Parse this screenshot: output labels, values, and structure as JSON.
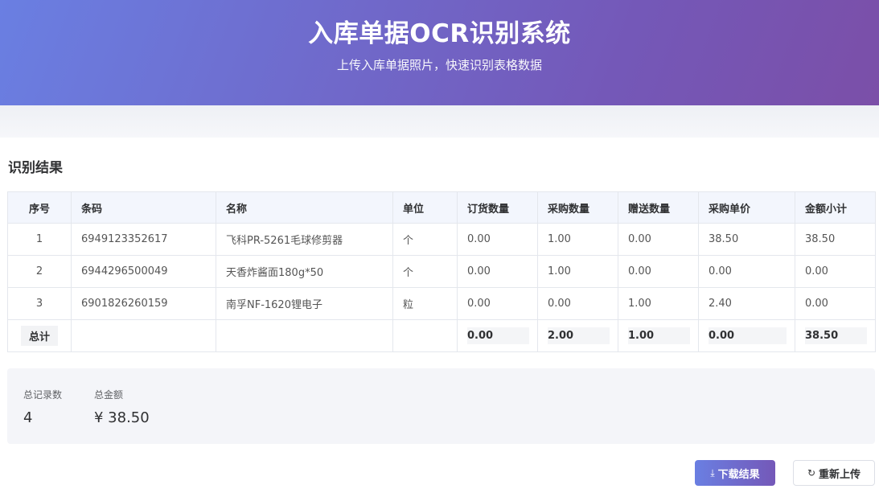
{
  "header": {
    "title": "入库单据OCR识别系统",
    "subtitle": "上传入库单据照片，快速识别表格数据"
  },
  "result": {
    "title": "识别结果",
    "columns": [
      "序号",
      "条码",
      "名称",
      "单位",
      "订货数量",
      "采购数量",
      "赠送数量",
      "采购单价",
      "金额小计"
    ],
    "rows": [
      [
        "1",
        "6949123352617",
        "飞科PR-5261毛球修剪器",
        "个",
        "0.00",
        "1.00",
        "0.00",
        "38.50",
        "38.50"
      ],
      [
        "2",
        "6944296500049",
        "天香炸酱面180g*50",
        "个",
        "0.00",
        "1.00",
        "0.00",
        "0.00",
        "0.00"
      ],
      [
        "3",
        "6901826260159",
        "南孚NF-1620锂电子",
        "粒",
        "0.00",
        "0.00",
        "1.00",
        "2.40",
        "0.00"
      ]
    ],
    "total": {
      "label": "总计",
      "order_qty": "0.00",
      "purchase_qty": "2.00",
      "gift_qty": "1.00",
      "unit_price": "0.00",
      "subtotal": "38.50"
    }
  },
  "summary": {
    "records_label": "总记录数",
    "records_value": "4",
    "amount_label": "总金额",
    "amount_value": "¥ 38.50"
  },
  "actions": {
    "download_label": "下载结果",
    "download_icon": "download-icon",
    "reupload_label": "重新上传",
    "reupload_icon": "refresh-icon"
  }
}
